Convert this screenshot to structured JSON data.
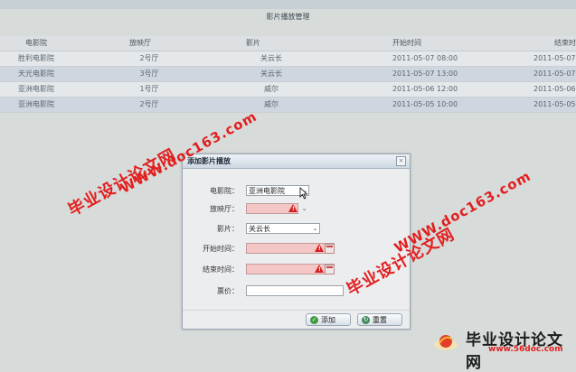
{
  "panel": {
    "title": "影片播放管理"
  },
  "grid": {
    "headers": [
      "电影院",
      "放映厅",
      "影片",
      "开始时间",
      "结束时"
    ],
    "rows": [
      [
        "胜利电影院",
        "2号厅",
        "关云长",
        "2011-05-07 08:00",
        "2011-05-07"
      ],
      [
        "天光电影院",
        "3号厅",
        "关云长",
        "2011-05-07 13:00",
        "2011-05-07"
      ],
      [
        "亚洲电影院",
        "1号厅",
        "威尔",
        "2011-05-06 12:00",
        "2011-05-06"
      ],
      [
        "亚洲电影院",
        "2号厅",
        "威尔",
        "2011-05-05 10:00",
        "2011-05-05"
      ]
    ]
  },
  "dialog": {
    "title": "添加影片播放",
    "close": "×",
    "fields": {
      "cinema": {
        "label": "电影院：",
        "value": "亚洲电影院"
      },
      "hall": {
        "label": "放映厅：",
        "value": ""
      },
      "movie": {
        "label": "影片：",
        "value": "关云长"
      },
      "start": {
        "label": "开始时间：",
        "value": ""
      },
      "end": {
        "label": "结束时间：",
        "value": ""
      },
      "price": {
        "label": "票价：",
        "value": ""
      }
    },
    "buttons": {
      "add": "添加",
      "reset": "重置"
    }
  },
  "watermarks": {
    "cn": "毕业设计论文网",
    "url": "WWW.doc163.com"
  },
  "brand": {
    "title": "毕业设计论文网",
    "url": "www.56doc.com"
  },
  "icons": {
    "warn": "warning-icon",
    "calendar": "calendar-icon",
    "dropdown": "chevron-down-icon"
  },
  "colors": {
    "error_bg": "#f4c6c6",
    "watermark": "#e21f1f",
    "alt_row": "#cfd6df"
  }
}
